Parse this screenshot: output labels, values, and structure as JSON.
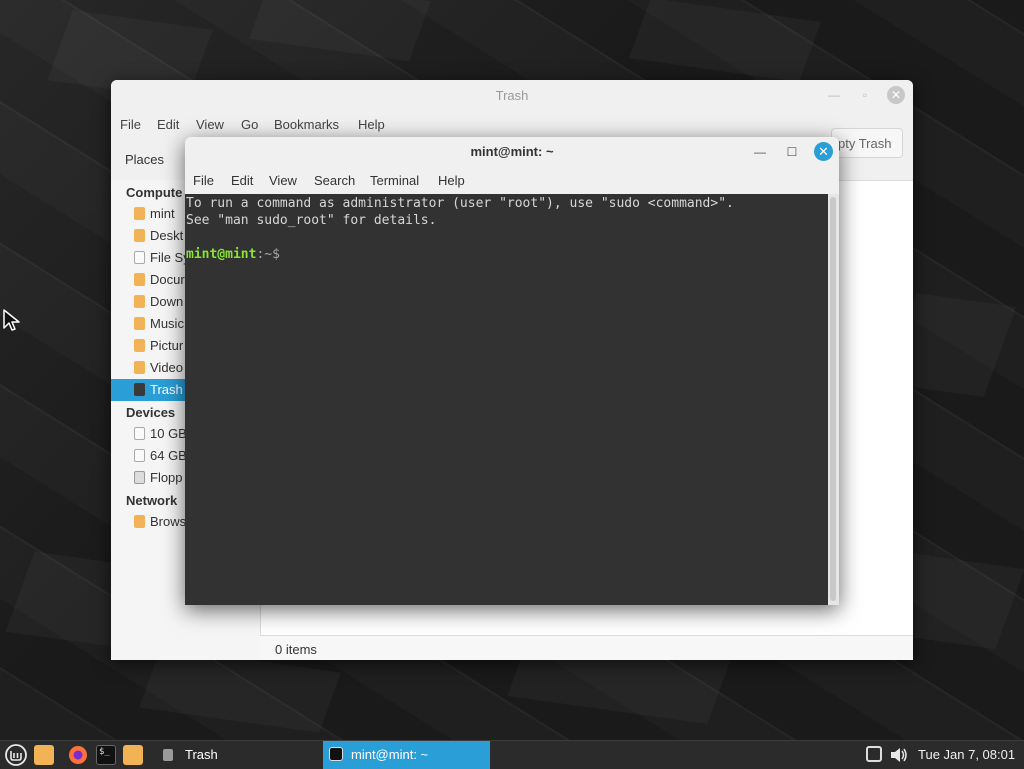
{
  "desktop": {
    "background_color": "#1e1e1e"
  },
  "file_manager": {
    "title": "Trash",
    "menu": [
      "File",
      "Edit",
      "View",
      "Go",
      "Bookmarks",
      "Help"
    ],
    "places_label": "Places",
    "empty_trash_label": "pty Trash",
    "sidebar": {
      "computer_header": "Compute",
      "computer_items": [
        {
          "label": "mint",
          "icon": "home-folder-icon"
        },
        {
          "label": "Deskt",
          "icon": "desktop-folder-icon"
        },
        {
          "label": "File Sy",
          "icon": "filesystem-icon"
        },
        {
          "label": "Docur",
          "icon": "documents-folder-icon"
        },
        {
          "label": "Down",
          "icon": "downloads-folder-icon"
        },
        {
          "label": "Music",
          "icon": "music-folder-icon"
        },
        {
          "label": "Pictur",
          "icon": "pictures-folder-icon"
        },
        {
          "label": "Video",
          "icon": "videos-folder-icon"
        },
        {
          "label": "Trash",
          "icon": "trash-icon",
          "selected": true
        }
      ],
      "devices_header": "Devices",
      "device_items": [
        {
          "label": "10 GB",
          "icon": "drive-icon"
        },
        {
          "label": "64 GB",
          "icon": "drive-icon"
        },
        {
          "label": "Flopp",
          "icon": "floppy-icon"
        }
      ],
      "network_header": "Network",
      "network_items": [
        {
          "label": "Brows",
          "icon": "network-folder-icon"
        }
      ]
    },
    "status": "0 items"
  },
  "terminal": {
    "title": "mint@mint: ~",
    "menu": [
      "File",
      "Edit",
      "View",
      "Search",
      "Terminal",
      "Help"
    ],
    "output_lines": [
      "To run a command as administrator (user \"root\"), use \"sudo <command>\".",
      "See \"man sudo_root\" for details."
    ],
    "prompt_user": "mint@mint",
    "prompt_path": ":~$",
    "colors": {
      "background": "#323232",
      "prompt": "#8ae234",
      "accent": "#2a9ed6"
    }
  },
  "taskbar": {
    "tasks": [
      {
        "label": "Trash",
        "icon": "trash-icon",
        "active": false
      },
      {
        "label": "mint@mint: ~",
        "icon": "terminal-icon",
        "active": true
      }
    ],
    "clock": "Tue Jan  7, 08:01"
  }
}
